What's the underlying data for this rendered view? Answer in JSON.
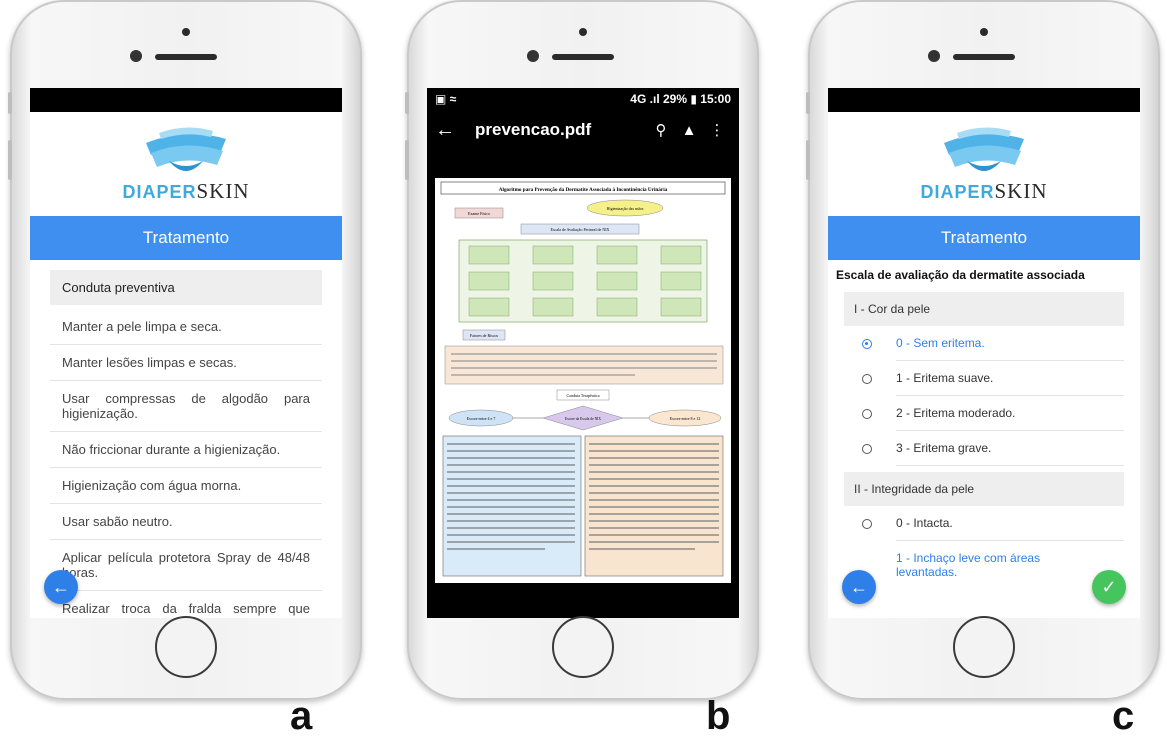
{
  "labels": {
    "a": "a",
    "b": "b",
    "c": "c"
  },
  "app": {
    "brand_part1": "DIAPER",
    "brand_part2": "SKIN",
    "colors": {
      "primary": "#3e8ff0",
      "fab_blue": "#2f7fe8",
      "fab_green": "#46c55e"
    }
  },
  "screen_a": {
    "header": "Tratamento",
    "section_head": "Conduta preventiva",
    "items": [
      "Manter a pele limpa e seca.",
      "Manter lesões limpas e secas.",
      "Usar compressas de algodão para higienização.",
      "Não friccionar durante a higienização.",
      "Higienização com água morna.",
      "Usar sabão neutro.",
      "Aplicar película protetora Spray de 48/48 horas.",
      "Realizar troca da fralda sempre que estiver molhada"
    ],
    "back_icon": "arrow-left-icon"
  },
  "screen_b": {
    "status": {
      "network": "4G",
      "battery": "29%",
      "time": "15:00"
    },
    "file_title": "prevencao.pdf",
    "icons": [
      "arrow-left-icon",
      "search-icon",
      "drive-icon",
      "more-vert-icon"
    ],
    "pdf": {
      "title": "Algoritmo para Prevenção da Dermatite Associada à Incontinência Urinária",
      "hygiene": "Higienização das mãos",
      "exam": "Exame Físico",
      "scale": "Escala de Avaliação Perineal de NIX",
      "risk": "Fatores de Riscos",
      "conduct": "Conduta Terapêutica",
      "score_center": "Escore da Escala de NIX",
      "score_left": "Escore entre 4 e 7",
      "score_right": "Escore entre 8 e 12"
    }
  },
  "screen_c": {
    "header": "Tratamento",
    "subtitle": "Escala de avaliação da dermatite associada",
    "section1": "I - Cor da pele",
    "options1": [
      "0 - Sem eritema.",
      "1 - Eritema suave.",
      "2 - Eritema moderado.",
      "3 - Eritema grave."
    ],
    "selected1": 0,
    "section2": "II - Integridade da pele",
    "options2": [
      "0 - Intacta.",
      "1 - Inchaço leve com áreas levantadas."
    ],
    "back_icon": "arrow-left-icon",
    "confirm_icon": "check-icon"
  }
}
